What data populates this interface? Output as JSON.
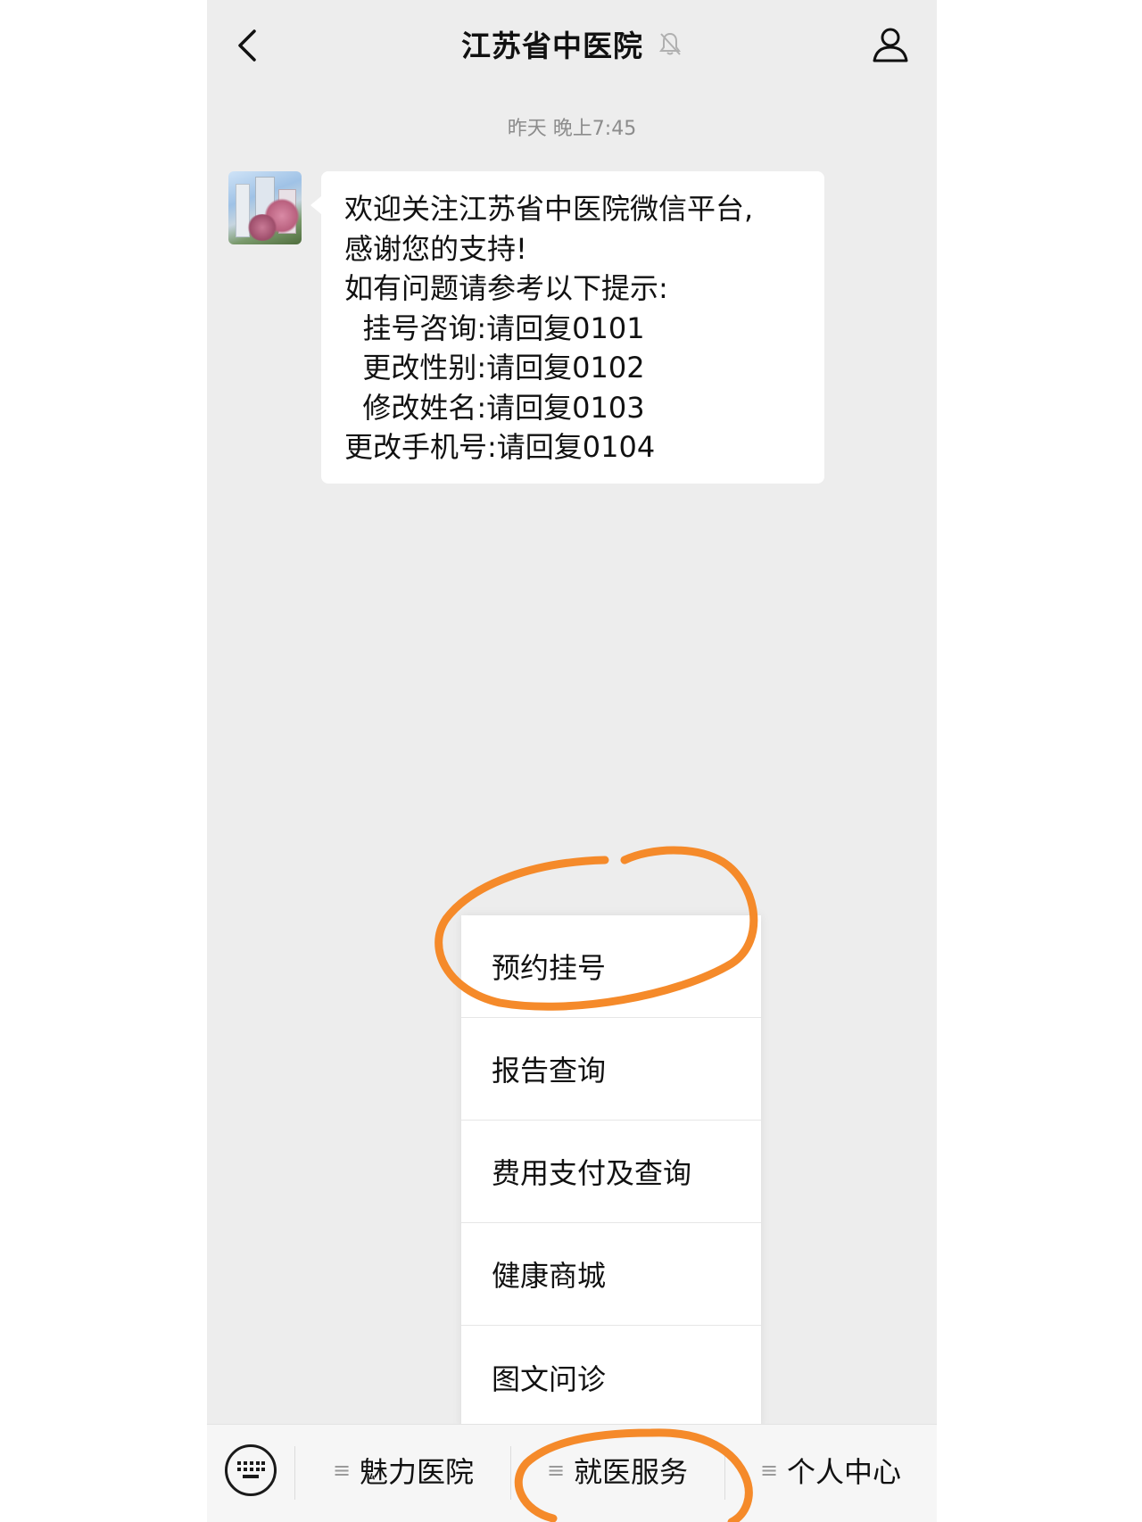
{
  "header": {
    "back_icon": "chevron-left-icon",
    "title": "江苏省中医院",
    "mute_icon": "bell-muted-icon",
    "profile_icon": "person-icon"
  },
  "chat": {
    "timestamp": "昨天 晚上7:45",
    "message": {
      "lines": [
        "欢迎关注江苏省中医院微信平台,",
        "感谢您的支持!",
        "如有问题请参考以下提示:",
        "  挂号咨询:请回复0101",
        "  更改性别:请回复0102",
        "  修改姓名:请回复0103",
        "更改手机号:请回复0104"
      ]
    }
  },
  "popup_menu": {
    "items": [
      {
        "label": "预约挂号"
      },
      {
        "label": "报告查询"
      },
      {
        "label": "费用支付及查询"
      },
      {
        "label": "健康商城"
      },
      {
        "label": "图文问诊"
      }
    ]
  },
  "bottom_bar": {
    "keyboard_icon": "keyboard-icon",
    "menu_glyph": "≡",
    "tabs": [
      {
        "label": "魅力医院"
      },
      {
        "label": "就医服务"
      },
      {
        "label": "个人中心"
      }
    ]
  },
  "colors": {
    "background": "#ededed",
    "bubble": "#ffffff",
    "annotation": "#f58a2a"
  }
}
